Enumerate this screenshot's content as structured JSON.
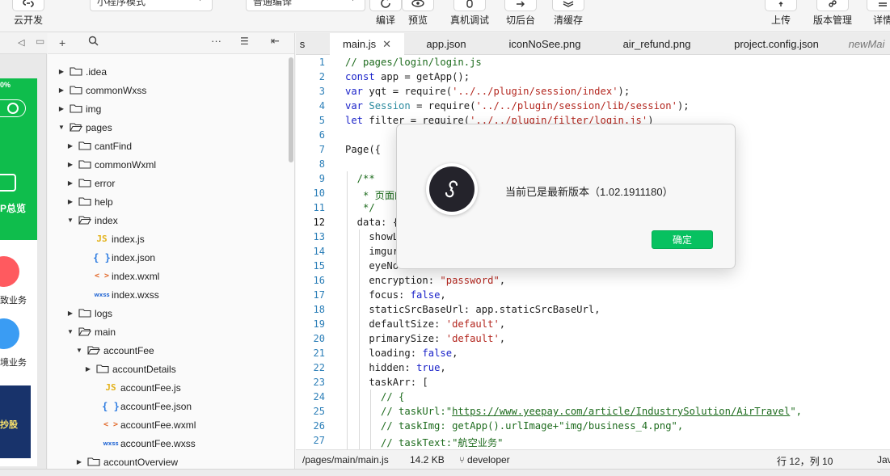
{
  "toolbar": {
    "cloud_label": "云开发",
    "mode_select": "小程序模式",
    "compile_select": "普通编译",
    "compile_label": "编译",
    "preview_label": "预览",
    "device_debug_label": "真机调试",
    "background_label": "切后台",
    "clear_cache_label": "清缓存",
    "upload_label": "上传",
    "version_label": "版本管理",
    "details_label": "详情"
  },
  "simulator": {
    "battery": "0%",
    "overview": "P总览",
    "business_1": "致业务",
    "business_2": "境业务",
    "banner": "抄股",
    "colors": {
      "green": "#0fbd4c",
      "red": "#ff5a5f",
      "blue": "#3a9cf3",
      "navy": "#18336b"
    }
  },
  "tree": [
    {
      "name": ".idea",
      "kind": "folder",
      "open": false,
      "depth": 0
    },
    {
      "name": "commonWxss",
      "kind": "folder",
      "open": false,
      "depth": 0
    },
    {
      "name": "img",
      "kind": "folder",
      "open": false,
      "depth": 0
    },
    {
      "name": "pages",
      "kind": "folder",
      "open": true,
      "depth": 0
    },
    {
      "name": "cantFind",
      "kind": "folder",
      "open": false,
      "depth": 1
    },
    {
      "name": "commonWxml",
      "kind": "folder",
      "open": false,
      "depth": 1
    },
    {
      "name": "error",
      "kind": "folder",
      "open": false,
      "depth": 1
    },
    {
      "name": "help",
      "kind": "folder",
      "open": false,
      "depth": 1
    },
    {
      "name": "index",
      "kind": "folder",
      "open": true,
      "depth": 1
    },
    {
      "name": "index.js",
      "kind": "js",
      "depth": 2
    },
    {
      "name": "index.json",
      "kind": "json",
      "depth": 2
    },
    {
      "name": "index.wxml",
      "kind": "wxml",
      "depth": 2
    },
    {
      "name": "index.wxss",
      "kind": "wxss",
      "depth": 2
    },
    {
      "name": "logs",
      "kind": "folder",
      "open": false,
      "depth": 1
    },
    {
      "name": "main",
      "kind": "folder",
      "open": true,
      "depth": 1
    },
    {
      "name": "accountFee",
      "kind": "folder",
      "open": true,
      "depth": 2
    },
    {
      "name": "accountDetails",
      "kind": "folder",
      "open": false,
      "depth": 3
    },
    {
      "name": "accountFee.js",
      "kind": "js",
      "depth": 3
    },
    {
      "name": "accountFee.json",
      "kind": "json",
      "depth": 3
    },
    {
      "name": "accountFee.wxml",
      "kind": "wxml",
      "depth": 3
    },
    {
      "name": "accountFee.wxss",
      "kind": "wxss",
      "depth": 3
    },
    {
      "name": "accountOverview",
      "kind": "folder",
      "open": false,
      "depth": 2
    }
  ],
  "file_icon_glyphs": {
    "js": "JS",
    "json": "{ }",
    "wxml": "< >",
    "wxss": "wxss"
  },
  "tabs": [
    {
      "label": "s",
      "active": false
    },
    {
      "label": "main.js",
      "active": true,
      "closable": true
    },
    {
      "label": "app.json",
      "active": false
    },
    {
      "label": "iconNoSee.png",
      "active": false
    },
    {
      "label": "air_refund.png",
      "active": false
    },
    {
      "label": "project.config.json",
      "active": false
    },
    {
      "label": "newMai",
      "active": false,
      "italic": true
    }
  ],
  "code_lines": [
    [
      {
        "t": "// pages/login/login.js",
        "c": "#1d6b1d"
      }
    ],
    [
      {
        "t": "const",
        "c": "#1a22c9"
      },
      {
        "t": " app = getApp();",
        "c": "#1f1f1f"
      }
    ],
    [
      {
        "t": "var",
        "c": "#1a22c9"
      },
      {
        "t": " yqt = require(",
        "c": "#1f1f1f"
      },
      {
        "t": "'../../plugin/session/index'",
        "c": "#b3261e"
      },
      {
        "t": ");",
        "c": "#1f1f1f"
      }
    ],
    [
      {
        "t": "var",
        "c": "#1a22c9"
      },
      {
        "t": " ",
        "c": "#1f1f1f"
      },
      {
        "t": "Session",
        "c": "#2a8a9e"
      },
      {
        "t": " = require(",
        "c": "#1f1f1f"
      },
      {
        "t": "'../../plugin/session/lib/session'",
        "c": "#b3261e"
      },
      {
        "t": ");",
        "c": "#1f1f1f"
      }
    ],
    [
      {
        "t": "let",
        "c": "#1a22c9"
      },
      {
        "t": " filter = require(",
        "c": "#1f1f1f"
      },
      {
        "t": "'../../plugin/filter/login.js'",
        "c": "#b3261e"
      },
      {
        "t": ")",
        "c": "#1f1f1f"
      }
    ],
    [
      {
        "t": "",
        "c": "#1f1f1f"
      }
    ],
    [
      {
        "t": "Page({",
        "c": "#1f1f1f"
      }
    ],
    [
      {
        "t": "",
        "c": "#1f1f1f"
      }
    ],
    [
      {
        "t": "  /**",
        "c": "#1d6b1d"
      }
    ],
    [
      {
        "t": "   * 页面的",
        "c": "#1d6b1d"
      }
    ],
    [
      {
        "t": "   */",
        "c": "#1d6b1d"
      }
    ],
    [
      {
        "t": "  data: {",
        "c": "#1f1f1f"
      }
    ],
    [
      {
        "t": "    showL",
        "c": "#1f1f1f"
      }
    ],
    [
      {
        "t": "    imgur",
        "c": "#1f1f1f"
      }
    ],
    [
      {
        "t": "    eyeNo",
        "c": "#1f1f1f"
      }
    ],
    [
      {
        "t": "    encryption: ",
        "c": "#1f1f1f"
      },
      {
        "t": "\"password\"",
        "c": "#b3261e"
      },
      {
        "t": ",",
        "c": "#1f1f1f"
      }
    ],
    [
      {
        "t": "    focus: ",
        "c": "#1f1f1f"
      },
      {
        "t": "false",
        "c": "#1a22c9"
      },
      {
        "t": ",",
        "c": "#1f1f1f"
      }
    ],
    [
      {
        "t": "    staticSrcBaseUrl: app.staticSrcBaseUrl,",
        "c": "#1f1f1f"
      }
    ],
    [
      {
        "t": "    defaultSize: ",
        "c": "#1f1f1f"
      },
      {
        "t": "'default'",
        "c": "#b3261e"
      },
      {
        "t": ",",
        "c": "#1f1f1f"
      }
    ],
    [
      {
        "t": "    primarySize: ",
        "c": "#1f1f1f"
      },
      {
        "t": "'default'",
        "c": "#b3261e"
      },
      {
        "t": ",",
        "c": "#1f1f1f"
      }
    ],
    [
      {
        "t": "    loading: ",
        "c": "#1f1f1f"
      },
      {
        "t": "false",
        "c": "#1a22c9"
      },
      {
        "t": ",",
        "c": "#1f1f1f"
      }
    ],
    [
      {
        "t": "    hidden: ",
        "c": "#1f1f1f"
      },
      {
        "t": "true",
        "c": "#1a22c9"
      },
      {
        "t": ",",
        "c": "#1f1f1f"
      }
    ],
    [
      {
        "t": "    taskArr: [",
        "c": "#1f1f1f"
      }
    ],
    [
      {
        "t": "      // {",
        "c": "#1d6b1d"
      }
    ],
    [
      {
        "t": "      // taskUrl:\"",
        "c": "#1d6b1d"
      },
      {
        "t": "https://www.yeepay.com/article/IndustrySolution/AirTravel",
        "c": "#1d6b1d",
        "u": true
      },
      {
        "t": "\",",
        "c": "#1d6b1d"
      }
    ],
    [
      {
        "t": "      // taskImg: getApp().urlImage+\"img/business_4.png\",",
        "c": "#1d6b1d"
      }
    ],
    [
      {
        "t": "      // taskText:\"航空业务\"",
        "c": "#1d6b1d"
      }
    ]
  ],
  "status": {
    "path": "/pages/main/main.js",
    "size": "14.2 KB",
    "branch": "developer",
    "position": "行 12，列 10",
    "lang": "Jav"
  },
  "dialog": {
    "message": "当前已是最新版本（1.02.1911180）",
    "ok_label": "确定"
  }
}
